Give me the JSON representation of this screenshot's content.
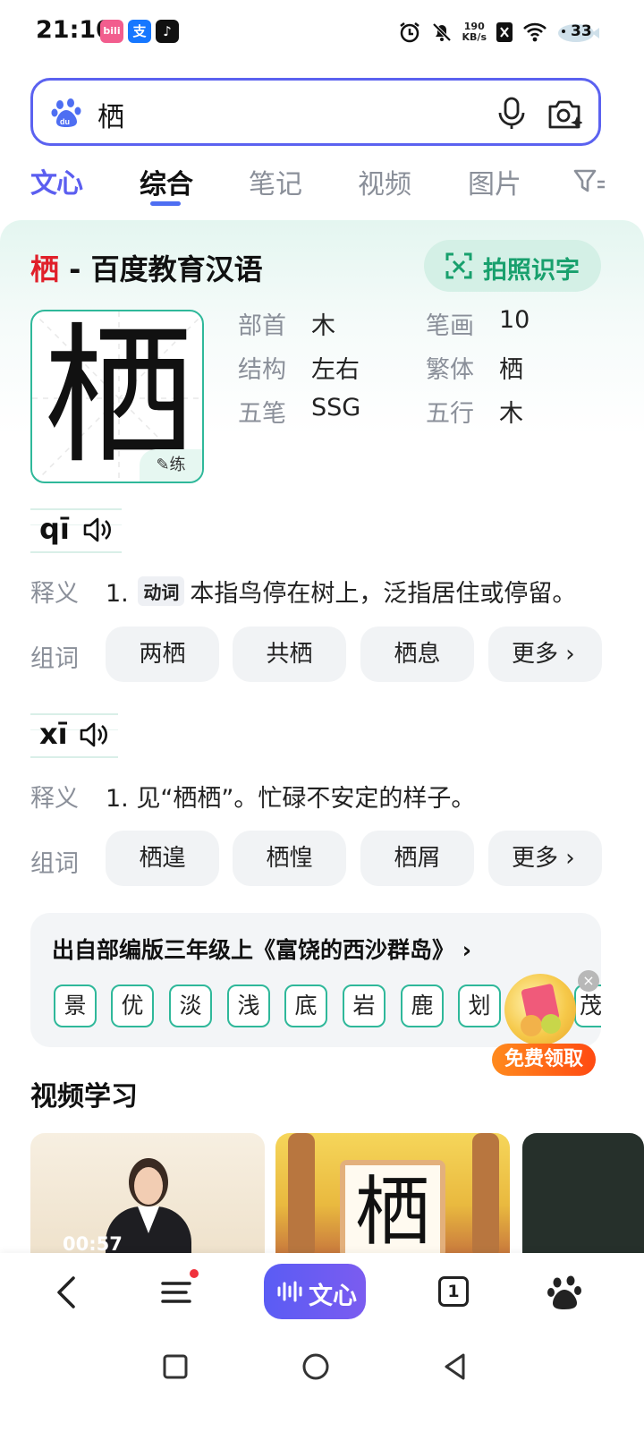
{
  "status_bar": {
    "time": "21:10",
    "net_speed_value": "190",
    "net_speed_unit": "KB/s",
    "battery": "33",
    "app_icons": [
      "bilibili-icon",
      "alipay-icon",
      "tiktok-icon"
    ],
    "right_icons": [
      "alarm-icon",
      "mute-icon",
      "net-speed",
      "nfc-icon",
      "wifi-icon",
      "battery-icon"
    ]
  },
  "search": {
    "query": "栖",
    "icons": [
      "baidu-paw-icon",
      "microphone-icon",
      "camera-search-icon"
    ]
  },
  "tabs": {
    "wenxin": "文心",
    "items": [
      "综合",
      "笔记",
      "视频",
      "图片"
    ],
    "active": "综合"
  },
  "card": {
    "title_char": "栖",
    "title_rest": " - 百度教育汉语",
    "photo_button": "拍照识字",
    "big_char": "栖",
    "practice_label": "练",
    "info": [
      {
        "key": "部首",
        "value": "木"
      },
      {
        "key": "笔画",
        "value": "10"
      },
      {
        "key": "结构",
        "value": "左右"
      },
      {
        "key": "繁体",
        "value": "栖"
      },
      {
        "key": "五笔",
        "value": "SSG"
      },
      {
        "key": "五行",
        "value": "木"
      }
    ],
    "readings": [
      {
        "pinyin": "qī",
        "definition_label": "释义",
        "definition_num": "1.",
        "pos": "动词",
        "definition": "本指鸟停在树上，泛指居住或停留。",
        "words_label": "组词",
        "words": [
          "两栖",
          "共栖",
          "栖息"
        ],
        "more": "更多"
      },
      {
        "pinyin": "xī",
        "definition_label": "释义",
        "definition_num": "1.",
        "definition": "见“栖栖”。忙碌不安定的样子。",
        "words_label": "组词",
        "words": [
          "栖遑",
          "栖惶",
          "栖屑"
        ],
        "more": "更多"
      }
    ],
    "source": {
      "title": "出自部编版三年级上《富饶的西沙群岛》",
      "chars": [
        "景",
        "优",
        "淡",
        "浅",
        "底",
        "岩",
        "鹿",
        "划",
        "",
        "茂"
      ]
    },
    "promo": "免费领取"
  },
  "video_section": {
    "title": "视频学习",
    "first_duration": "00:57",
    "second_char": "栖"
  },
  "bottom_nav": {
    "wenxin": "文心",
    "tab_count": "1"
  },
  "colors": {
    "accent": "#5b62f0",
    "title_red": "#e0202a",
    "green": "#2fb89a",
    "photo_green": "#18a06d"
  }
}
